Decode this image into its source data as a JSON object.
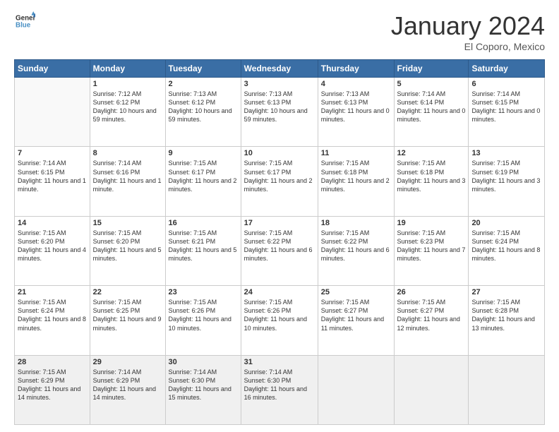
{
  "logo": {
    "line1": "General",
    "line2": "Blue"
  },
  "title": "January 2024",
  "location": "El Coporo, Mexico",
  "days_header": [
    "Sunday",
    "Monday",
    "Tuesday",
    "Wednesday",
    "Thursday",
    "Friday",
    "Saturday"
  ],
  "weeks": [
    [
      {
        "day": "",
        "sunrise": "",
        "sunset": "",
        "daylight": ""
      },
      {
        "day": "1",
        "sunrise": "Sunrise: 7:12 AM",
        "sunset": "Sunset: 6:12 PM",
        "daylight": "Daylight: 10 hours and 59 minutes."
      },
      {
        "day": "2",
        "sunrise": "Sunrise: 7:13 AM",
        "sunset": "Sunset: 6:12 PM",
        "daylight": "Daylight: 10 hours and 59 minutes."
      },
      {
        "day": "3",
        "sunrise": "Sunrise: 7:13 AM",
        "sunset": "Sunset: 6:13 PM",
        "daylight": "Daylight: 10 hours and 59 minutes."
      },
      {
        "day": "4",
        "sunrise": "Sunrise: 7:13 AM",
        "sunset": "Sunset: 6:13 PM",
        "daylight": "Daylight: 11 hours and 0 minutes."
      },
      {
        "day": "5",
        "sunrise": "Sunrise: 7:14 AM",
        "sunset": "Sunset: 6:14 PM",
        "daylight": "Daylight: 11 hours and 0 minutes."
      },
      {
        "day": "6",
        "sunrise": "Sunrise: 7:14 AM",
        "sunset": "Sunset: 6:15 PM",
        "daylight": "Daylight: 11 hours and 0 minutes."
      }
    ],
    [
      {
        "day": "7",
        "sunrise": "Sunrise: 7:14 AM",
        "sunset": "Sunset: 6:15 PM",
        "daylight": "Daylight: 11 hours and 1 minute."
      },
      {
        "day": "8",
        "sunrise": "Sunrise: 7:14 AM",
        "sunset": "Sunset: 6:16 PM",
        "daylight": "Daylight: 11 hours and 1 minute."
      },
      {
        "day": "9",
        "sunrise": "Sunrise: 7:15 AM",
        "sunset": "Sunset: 6:17 PM",
        "daylight": "Daylight: 11 hours and 2 minutes."
      },
      {
        "day": "10",
        "sunrise": "Sunrise: 7:15 AM",
        "sunset": "Sunset: 6:17 PM",
        "daylight": "Daylight: 11 hours and 2 minutes."
      },
      {
        "day": "11",
        "sunrise": "Sunrise: 7:15 AM",
        "sunset": "Sunset: 6:18 PM",
        "daylight": "Daylight: 11 hours and 2 minutes."
      },
      {
        "day": "12",
        "sunrise": "Sunrise: 7:15 AM",
        "sunset": "Sunset: 6:18 PM",
        "daylight": "Daylight: 11 hours and 3 minutes."
      },
      {
        "day": "13",
        "sunrise": "Sunrise: 7:15 AM",
        "sunset": "Sunset: 6:19 PM",
        "daylight": "Daylight: 11 hours and 3 minutes."
      }
    ],
    [
      {
        "day": "14",
        "sunrise": "Sunrise: 7:15 AM",
        "sunset": "Sunset: 6:20 PM",
        "daylight": "Daylight: 11 hours and 4 minutes."
      },
      {
        "day": "15",
        "sunrise": "Sunrise: 7:15 AM",
        "sunset": "Sunset: 6:20 PM",
        "daylight": "Daylight: 11 hours and 5 minutes."
      },
      {
        "day": "16",
        "sunrise": "Sunrise: 7:15 AM",
        "sunset": "Sunset: 6:21 PM",
        "daylight": "Daylight: 11 hours and 5 minutes."
      },
      {
        "day": "17",
        "sunrise": "Sunrise: 7:15 AM",
        "sunset": "Sunset: 6:22 PM",
        "daylight": "Daylight: 11 hours and 6 minutes."
      },
      {
        "day": "18",
        "sunrise": "Sunrise: 7:15 AM",
        "sunset": "Sunset: 6:22 PM",
        "daylight": "Daylight: 11 hours and 6 minutes."
      },
      {
        "day": "19",
        "sunrise": "Sunrise: 7:15 AM",
        "sunset": "Sunset: 6:23 PM",
        "daylight": "Daylight: 11 hours and 7 minutes."
      },
      {
        "day": "20",
        "sunrise": "Sunrise: 7:15 AM",
        "sunset": "Sunset: 6:24 PM",
        "daylight": "Daylight: 11 hours and 8 minutes."
      }
    ],
    [
      {
        "day": "21",
        "sunrise": "Sunrise: 7:15 AM",
        "sunset": "Sunset: 6:24 PM",
        "daylight": "Daylight: 11 hours and 8 minutes."
      },
      {
        "day": "22",
        "sunrise": "Sunrise: 7:15 AM",
        "sunset": "Sunset: 6:25 PM",
        "daylight": "Daylight: 11 hours and 9 minutes."
      },
      {
        "day": "23",
        "sunrise": "Sunrise: 7:15 AM",
        "sunset": "Sunset: 6:26 PM",
        "daylight": "Daylight: 11 hours and 10 minutes."
      },
      {
        "day": "24",
        "sunrise": "Sunrise: 7:15 AM",
        "sunset": "Sunset: 6:26 PM",
        "daylight": "Daylight: 11 hours and 10 minutes."
      },
      {
        "day": "25",
        "sunrise": "Sunrise: 7:15 AM",
        "sunset": "Sunset: 6:27 PM",
        "daylight": "Daylight: 11 hours and 11 minutes."
      },
      {
        "day": "26",
        "sunrise": "Sunrise: 7:15 AM",
        "sunset": "Sunset: 6:27 PM",
        "daylight": "Daylight: 11 hours and 12 minutes."
      },
      {
        "day": "27",
        "sunrise": "Sunrise: 7:15 AM",
        "sunset": "Sunset: 6:28 PM",
        "daylight": "Daylight: 11 hours and 13 minutes."
      }
    ],
    [
      {
        "day": "28",
        "sunrise": "Sunrise: 7:15 AM",
        "sunset": "Sunset: 6:29 PM",
        "daylight": "Daylight: 11 hours and 14 minutes."
      },
      {
        "day": "29",
        "sunrise": "Sunrise: 7:14 AM",
        "sunset": "Sunset: 6:29 PM",
        "daylight": "Daylight: 11 hours and 14 minutes."
      },
      {
        "day": "30",
        "sunrise": "Sunrise: 7:14 AM",
        "sunset": "Sunset: 6:30 PM",
        "daylight": "Daylight: 11 hours and 15 minutes."
      },
      {
        "day": "31",
        "sunrise": "Sunrise: 7:14 AM",
        "sunset": "Sunset: 6:30 PM",
        "daylight": "Daylight: 11 hours and 16 minutes."
      },
      {
        "day": "",
        "sunrise": "",
        "sunset": "",
        "daylight": ""
      },
      {
        "day": "",
        "sunrise": "",
        "sunset": "",
        "daylight": ""
      },
      {
        "day": "",
        "sunrise": "",
        "sunset": "",
        "daylight": ""
      }
    ]
  ]
}
